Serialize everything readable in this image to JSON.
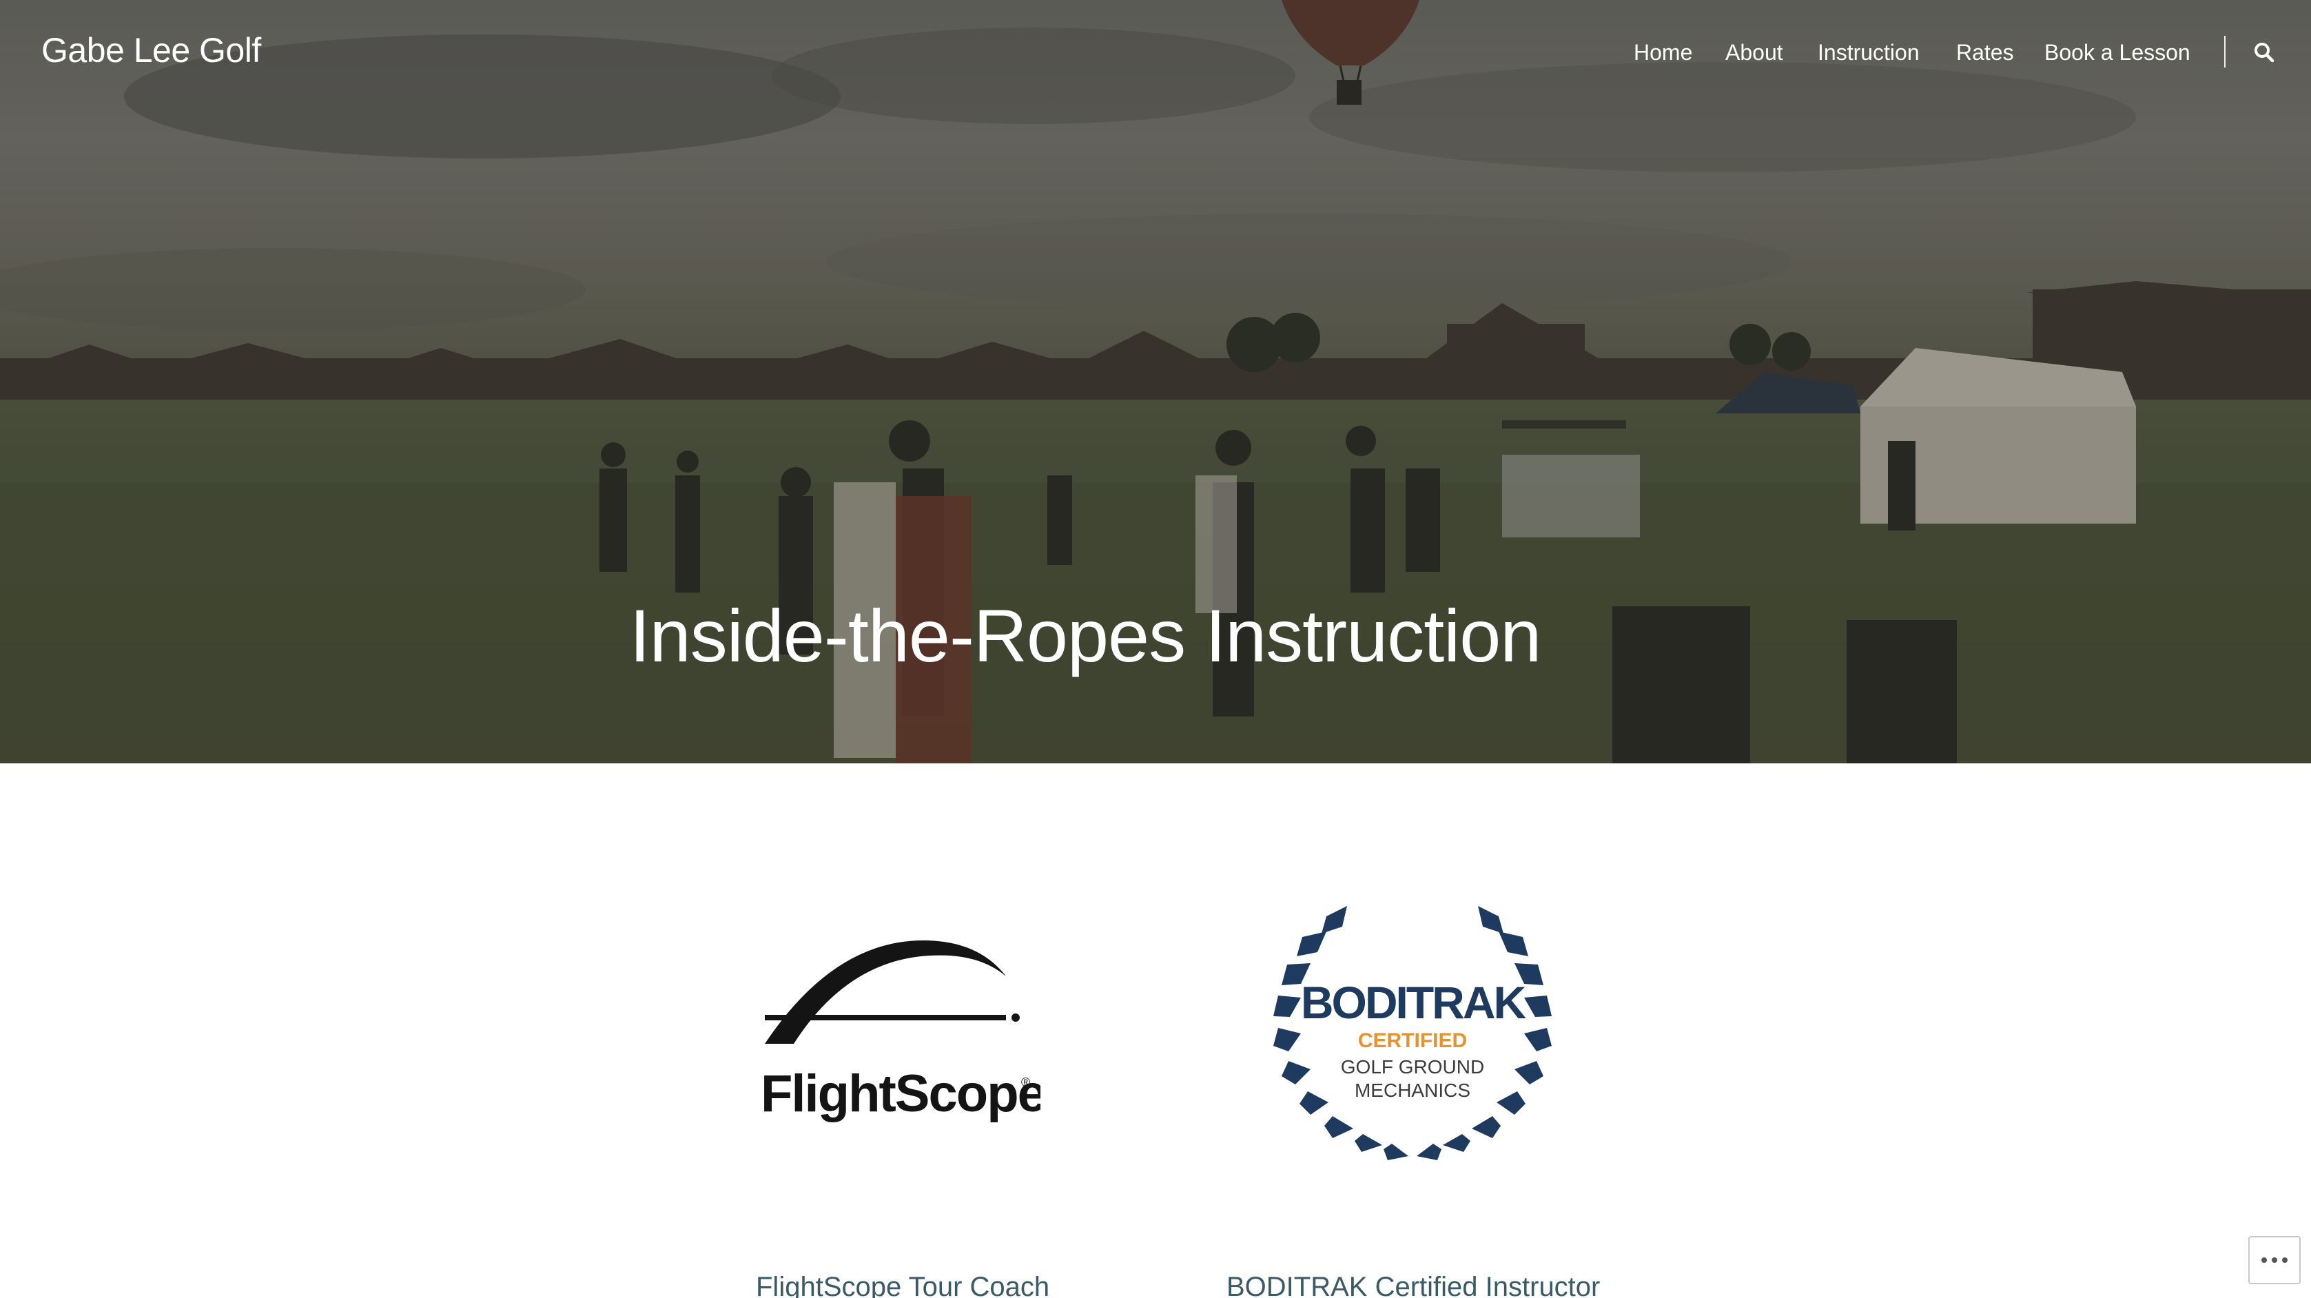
{
  "site": {
    "title": "Gabe Lee Golf"
  },
  "nav": {
    "items": [
      {
        "label": "Home"
      },
      {
        "label": "About"
      },
      {
        "label": "Instruction"
      },
      {
        "label": "Rates"
      },
      {
        "label": "Book a Lesson"
      }
    ],
    "search_icon": "search-icon"
  },
  "hero": {
    "title": "Inside-the-Ropes Instruction"
  },
  "certifications": [
    {
      "logo_text": "FlightScope",
      "logo_mark": "®",
      "link_label": "FlightScope Tour Coach"
    },
    {
      "logo_brand": "BODITRAK",
      "logo_certified": "CERTIFIED",
      "logo_line1": "GOLF GROUND",
      "logo_line2": "MECHANICS",
      "link_label": "BODITRAK Certified Instructor"
    }
  ],
  "colors": {
    "link": "#3a5a66",
    "boditrak_navy": "#1f3a5f",
    "boditrak_orange": "#e8922e"
  },
  "more_menu_icon": "more-dots-icon"
}
